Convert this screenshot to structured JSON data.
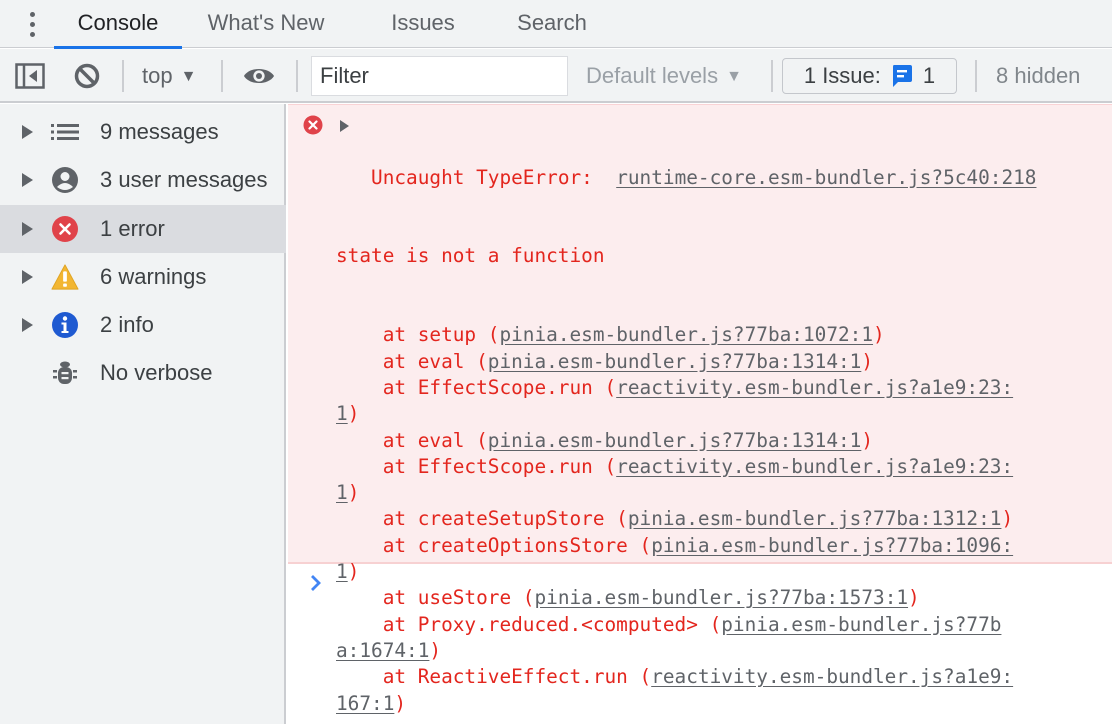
{
  "tabs": [
    {
      "label": "Console",
      "active": true
    },
    {
      "label": "What's New",
      "active": false
    },
    {
      "label": "Issues",
      "active": false
    },
    {
      "label": "Search",
      "active": false
    }
  ],
  "toolbar": {
    "sidebar_toggle_icon": "sidebar-toggle-icon",
    "clear_icon": "clear-console-icon",
    "context": "top",
    "live_expression_icon": "eye-icon",
    "filter_placeholder": "Filter",
    "filter_value": "",
    "levels": "Default levels",
    "issues_label": "1 Issue:",
    "issues_count": "1",
    "hidden": "8 hidden"
  },
  "sidebar": {
    "items": [
      {
        "label": "9 messages",
        "icon": "list-icon",
        "expandable": true,
        "selected": false
      },
      {
        "label": "3 user messages",
        "icon": "user-icon",
        "expandable": true,
        "selected": false
      },
      {
        "label": "1 error",
        "icon": "error-icon",
        "expandable": true,
        "selected": true
      },
      {
        "label": "6 warnings",
        "icon": "warning-icon",
        "expandable": true,
        "selected": false
      },
      {
        "label": "2 info",
        "icon": "info-icon",
        "expandable": true,
        "selected": false
      },
      {
        "label": "No verbose",
        "icon": "bug-icon",
        "expandable": false,
        "selected": false
      }
    ]
  },
  "console": {
    "error": {
      "prefix": "Uncaught TypeError: ",
      "source": "runtime-core.esm-bundler.js?5c40:218",
      "message": "state is not a function",
      "lines": [
        {
          "pre": "    at setup (",
          "link": "pinia.esm-bundler.js?77ba:1072:1",
          "post": ")"
        },
        {
          "pre": "    at eval (",
          "link": "pinia.esm-bundler.js?77ba:1314:1",
          "post": ")"
        },
        {
          "pre": "    at EffectScope.run (",
          "link": "reactivity.esm-bundler.js?a1e9:23:",
          "post": ""
        },
        {
          "pre": "",
          "link": "1",
          "post": ")"
        },
        {
          "pre": "    at eval (",
          "link": "pinia.esm-bundler.js?77ba:1314:1",
          "post": ")"
        },
        {
          "pre": "    at EffectScope.run (",
          "link": "reactivity.esm-bundler.js?a1e9:23:",
          "post": ""
        },
        {
          "pre": "",
          "link": "1",
          "post": ")"
        },
        {
          "pre": "    at createSetupStore (",
          "link": "pinia.esm-bundler.js?77ba:1312:1",
          "post": ")"
        },
        {
          "pre": "    at createOptionsStore (",
          "link": "pinia.esm-bundler.js?77ba:1096:",
          "post": ""
        },
        {
          "pre": "",
          "link": "1",
          "post": ")"
        },
        {
          "pre": "    at useStore (",
          "link": "pinia.esm-bundler.js?77ba:1573:1",
          "post": ")"
        },
        {
          "pre": "    at Proxy.reduced.<computed> (",
          "link": "pinia.esm-bundler.js?77b",
          "post": ""
        },
        {
          "pre": "",
          "link": "a:1674:1",
          "post": ")"
        },
        {
          "pre": "    at ReactiveEffect.run (",
          "link": "reactivity.esm-bundler.js?a1e9:",
          "post": ""
        },
        {
          "pre": "",
          "link": "167:1",
          "post": ")"
        }
      ]
    },
    "prompt_value": ""
  },
  "colors": {
    "accent": "#1a73e8",
    "error_text": "#e3261e",
    "error_bg": "#fcedee",
    "link": "#5f6368",
    "warning": "#f2b632",
    "info": "#1f5ad1",
    "error_icon": "#e0434a"
  }
}
